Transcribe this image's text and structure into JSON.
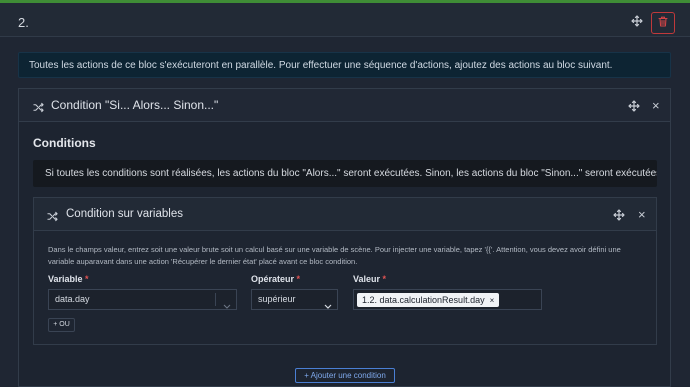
{
  "block": {
    "number": "2.",
    "move_icon": "move-icon",
    "delete_icon": "trash-icon",
    "accent_color": "#3f8d36",
    "delete_color": "#c0393b"
  },
  "info_message": "Toutes les actions de ce bloc s'exécuteront en parallèle. Pour effectuer une séquence d'actions, ajoutez des actions au bloc suivant.",
  "condition_panel": {
    "icon": "shuffle-icon",
    "title": "Condition \"Si... Alors... Sinon...\"",
    "section_title": "Conditions",
    "note": "Si toutes les conditions sont réalisées, les actions du bloc \"Alors...\" seront exécutées. Sinon, les actions du bloc \"Sinon...\" seront exécutées.",
    "close_label": "×",
    "add_condition_label": "+ Ajouter une condition"
  },
  "variable_panel": {
    "icon": "shuffle-icon",
    "title": "Condition sur variables",
    "close_label": "×",
    "help_text": "Dans le champs valeur, entrez soit une valeur brute soit un calcul basé sur une variable de scène. Pour injecter une variable, tapez '{{'. Attention, vous devez avoir défini une variable auparavant dans une action 'Récupérer le dernier état' placé avant ce bloc condition.",
    "variable": {
      "label": "Variable",
      "required": "*",
      "value": "data.day"
    },
    "operator": {
      "label": "Opérateur",
      "required": "*",
      "value": "supérieur"
    },
    "value": {
      "label": "Valeur",
      "required": "*",
      "tag": "1.2. data.calculationResult.day",
      "tag_remove": "×"
    },
    "or_button_label": "+ OU"
  }
}
